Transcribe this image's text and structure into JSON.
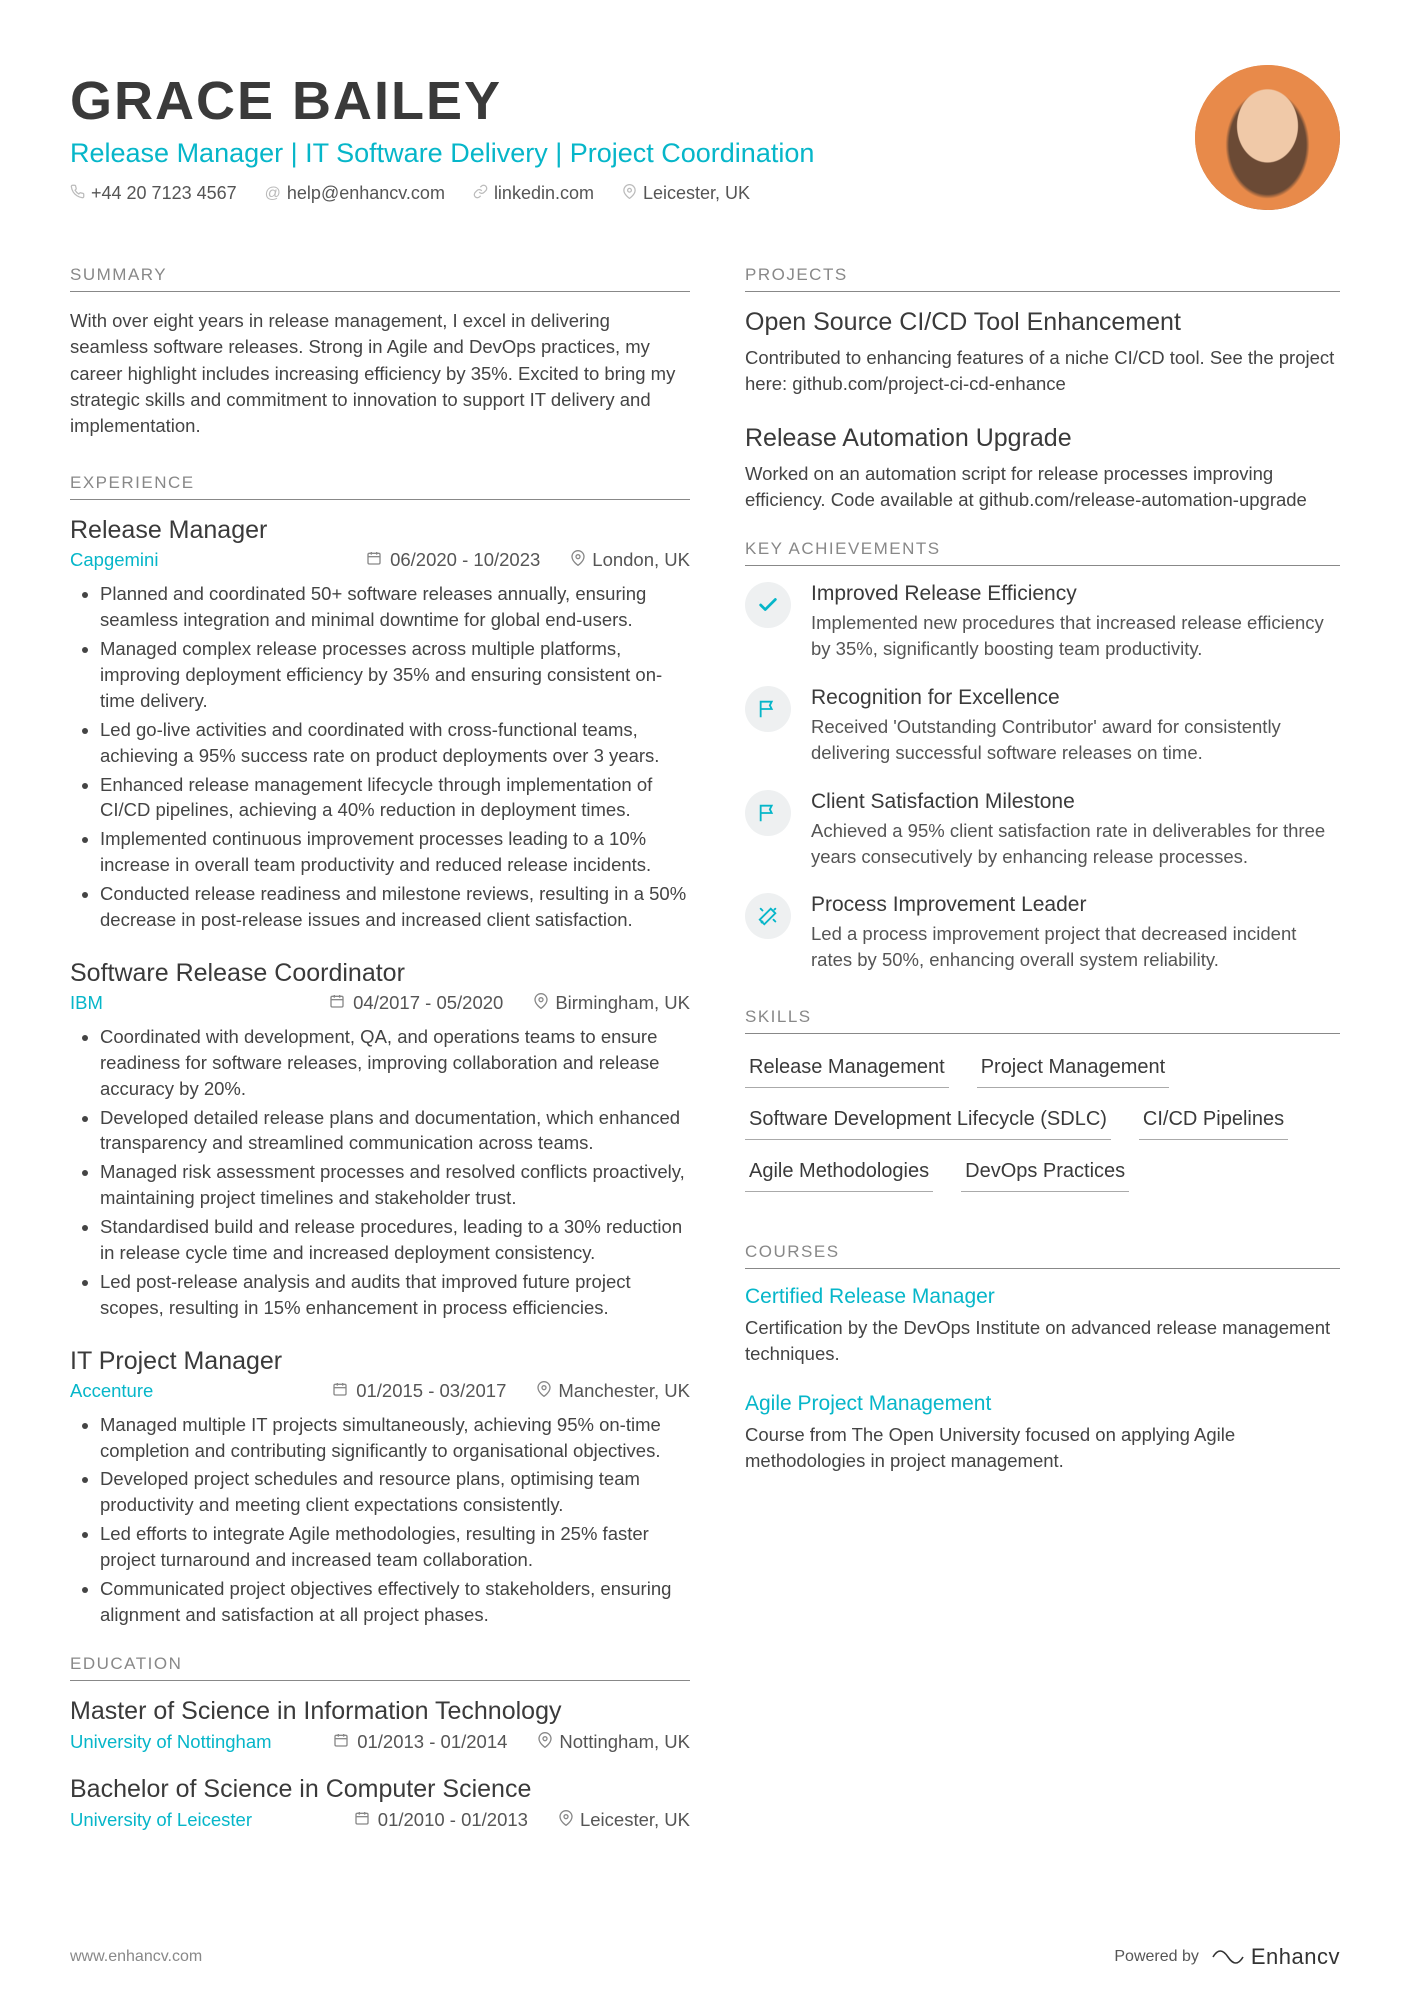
{
  "header": {
    "name": "GRACE BAILEY",
    "tagline": "Release Manager | IT Software Delivery | Project Coordination",
    "phone": "+44 20 7123 4567",
    "email": "help@enhancv.com",
    "link": "linkedin.com",
    "location": "Leicester, UK"
  },
  "sections": {
    "summary_heading": "SUMMARY",
    "summary_text": "With over eight years in release management, I excel in delivering seamless software releases. Strong in Agile and DevOps practices, my career highlight includes increasing efficiency by 35%. Excited to bring my strategic skills and commitment to innovation to support IT delivery and implementation.",
    "experience_heading": "EXPERIENCE",
    "education_heading": "EDUCATION",
    "projects_heading": "PROJECTS",
    "achievements_heading": "KEY ACHIEVEMENTS",
    "skills_heading": "SKILLS",
    "courses_heading": "COURSES"
  },
  "experience": [
    {
      "title": "Release Manager",
      "company": "Capgemini",
      "dates": "06/2020 - 10/2023",
      "location": "London, UK",
      "bullets": [
        "Planned and coordinated 50+ software releases annually, ensuring seamless integration and minimal downtime for global end-users.",
        "Managed complex release processes across multiple platforms, improving deployment efficiency by 35% and ensuring consistent on-time delivery.",
        "Led go-live activities and coordinated with cross-functional teams, achieving a 95% success rate on product deployments over 3 years.",
        "Enhanced release management lifecycle through implementation of CI/CD pipelines, achieving a 40% reduction in deployment times.",
        "Implemented continuous improvement processes leading to a 10% increase in overall team productivity and reduced release incidents.",
        "Conducted release readiness and milestone reviews, resulting in a 50% decrease in post-release issues and increased client satisfaction."
      ]
    },
    {
      "title": "Software Release Coordinator",
      "company": "IBM",
      "dates": "04/2017 - 05/2020",
      "location": "Birmingham, UK",
      "bullets": [
        "Coordinated with development, QA, and operations teams to ensure readiness for software releases, improving collaboration and release accuracy by 20%.",
        "Developed detailed release plans and documentation, which enhanced transparency and streamlined communication across teams.",
        "Managed risk assessment processes and resolved conflicts proactively, maintaining project timelines and stakeholder trust.",
        "Standardised build and release procedures, leading to a 30% reduction in release cycle time and increased deployment consistency.",
        "Led post-release analysis and audits that improved future project scopes, resulting in 15% enhancement in process efficiencies."
      ]
    },
    {
      "title": "IT Project Manager",
      "company": "Accenture",
      "dates": "01/2015 - 03/2017",
      "location": "Manchester, UK",
      "bullets": [
        "Managed multiple IT projects simultaneously, achieving 95% on-time completion and contributing significantly to organisational objectives.",
        "Developed project schedules and resource plans, optimising team productivity and meeting client expectations consistently.",
        "Led efforts to integrate Agile methodologies, resulting in 25% faster project turnaround and increased team collaboration.",
        "Communicated project objectives effectively to stakeholders, ensuring alignment and satisfaction at all project phases."
      ]
    }
  ],
  "education": [
    {
      "title": "Master of Science in Information Technology",
      "school": "University of Nottingham",
      "dates": "01/2013 - 01/2014",
      "location": "Nottingham, UK"
    },
    {
      "title": "Bachelor of Science in Computer Science",
      "school": "University of Leicester",
      "dates": "01/2010 - 01/2013",
      "location": "Leicester, UK"
    }
  ],
  "projects": [
    {
      "title": "Open Source CI/CD Tool Enhancement",
      "desc": "Contributed to enhancing features of a niche CI/CD tool. See the project here: github.com/project-ci-cd-enhance"
    },
    {
      "title": "Release Automation Upgrade",
      "desc": "Worked on an automation script for release processes improving efficiency. Code available at github.com/release-automation-upgrade"
    }
  ],
  "achievements": [
    {
      "icon": "check",
      "title": "Improved Release Efficiency",
      "desc": "Implemented new procedures that increased release efficiency by 35%, significantly boosting team productivity."
    },
    {
      "icon": "flag",
      "title": "Recognition for Excellence",
      "desc": "Received 'Outstanding Contributor' award for consistently delivering successful software releases on time."
    },
    {
      "icon": "flag",
      "title": "Client Satisfaction Milestone",
      "desc": "Achieved a 95% client satisfaction rate in deliverables for three years consecutively by enhancing release processes."
    },
    {
      "icon": "wand",
      "title": "Process Improvement Leader",
      "desc": "Led a process improvement project that decreased incident rates by 50%, enhancing overall system reliability."
    }
  ],
  "skills": [
    "Release Management",
    "Project Management",
    "Software Development Lifecycle (SDLC)",
    "CI/CD Pipelines",
    "Agile Methodologies",
    "DevOps Practices"
  ],
  "courses": [
    {
      "title": "Certified Release Manager",
      "desc": "Certification by the DevOps Institute on advanced release management techniques."
    },
    {
      "title": "Agile Project Management",
      "desc": "Course from The Open University focused on applying Agile methodologies in project management."
    }
  ],
  "footer": {
    "url": "www.enhancv.com",
    "powered": "Powered by",
    "brand": "Enhancv"
  }
}
